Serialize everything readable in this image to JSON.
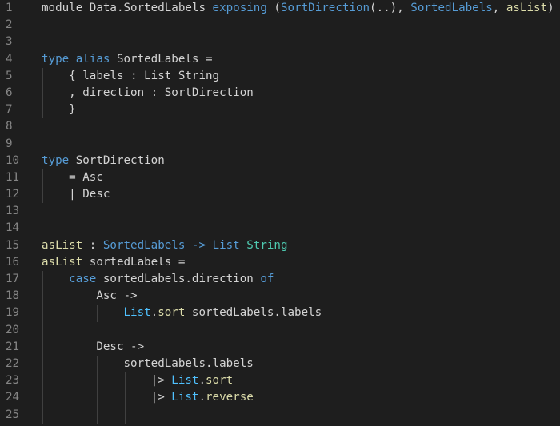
{
  "colors": {
    "background": "#1e1e1e",
    "line_number": "#858585",
    "plain": "#d4d4d4",
    "keyword": "#569cd6",
    "function": "#dcdcaa",
    "type": "#4ec9b0",
    "module": "#4fc1ff",
    "indent_guide": "#404040"
  },
  "lines": [
    {
      "n": "1",
      "guides": 0,
      "tokens": [
        {
          "t": "module ",
          "c": "plain"
        },
        {
          "t": "Data.SortedLabels ",
          "c": "plain"
        },
        {
          "t": "exposing",
          "c": "keyword"
        },
        {
          "t": " (",
          "c": "plain"
        },
        {
          "t": "SortDirection",
          "c": "keyword"
        },
        {
          "t": "(..), ",
          "c": "plain"
        },
        {
          "t": "SortedLabels",
          "c": "keyword"
        },
        {
          "t": ", ",
          "c": "plain"
        },
        {
          "t": "asList",
          "c": "function"
        },
        {
          "t": ")",
          "c": "plain"
        }
      ]
    },
    {
      "n": "2",
      "guides": 0,
      "tokens": []
    },
    {
      "n": "3",
      "guides": 0,
      "tokens": []
    },
    {
      "n": "4",
      "guides": 0,
      "tokens": [
        {
          "t": "type",
          "c": "keyword"
        },
        {
          "t": " ",
          "c": "plain"
        },
        {
          "t": "alias",
          "c": "keyword"
        },
        {
          "t": " SortedLabels =",
          "c": "plain"
        }
      ]
    },
    {
      "n": "5",
      "guides": 1,
      "tokens": [
        {
          "t": "    { labels : List String",
          "c": "plain"
        }
      ]
    },
    {
      "n": "6",
      "guides": 1,
      "tokens": [
        {
          "t": "    , direction : SortDirection",
          "c": "plain"
        }
      ]
    },
    {
      "n": "7",
      "guides": 1,
      "tokens": [
        {
          "t": "    }",
          "c": "plain"
        }
      ]
    },
    {
      "n": "8",
      "guides": 0,
      "tokens": []
    },
    {
      "n": "9",
      "guides": 0,
      "tokens": []
    },
    {
      "n": "10",
      "guides": 0,
      "tokens": [
        {
          "t": "type",
          "c": "keyword"
        },
        {
          "t": " SortDirection",
          "c": "plain"
        }
      ]
    },
    {
      "n": "11",
      "guides": 1,
      "tokens": [
        {
          "t": "    = Asc",
          "c": "plain"
        }
      ]
    },
    {
      "n": "12",
      "guides": 1,
      "tokens": [
        {
          "t": "    | Desc",
          "c": "plain"
        }
      ]
    },
    {
      "n": "13",
      "guides": 0,
      "tokens": []
    },
    {
      "n": "14",
      "guides": 0,
      "tokens": []
    },
    {
      "n": "15",
      "guides": 0,
      "tokens": [
        {
          "t": "asList",
          "c": "function"
        },
        {
          "t": " : ",
          "c": "plain"
        },
        {
          "t": "SortedLabels",
          "c": "keyword"
        },
        {
          "t": " -> ",
          "c": "keyword"
        },
        {
          "t": "List",
          "c": "keyword"
        },
        {
          "t": " ",
          "c": "plain"
        },
        {
          "t": "String",
          "c": "type"
        }
      ]
    },
    {
      "n": "16",
      "guides": 0,
      "tokens": [
        {
          "t": "asList",
          "c": "function"
        },
        {
          "t": " sortedLabels =",
          "c": "plain"
        }
      ]
    },
    {
      "n": "17",
      "guides": 1,
      "tokens": [
        {
          "t": "    ",
          "c": "plain"
        },
        {
          "t": "case",
          "c": "keyword"
        },
        {
          "t": " sortedLabels.direction ",
          "c": "plain"
        },
        {
          "t": "of",
          "c": "keyword"
        }
      ]
    },
    {
      "n": "18",
      "guides": 2,
      "tokens": [
        {
          "t": "        Asc ->",
          "c": "plain"
        }
      ]
    },
    {
      "n": "19",
      "guides": 3,
      "tokens": [
        {
          "t": "            ",
          "c": "plain"
        },
        {
          "t": "List",
          "c": "module"
        },
        {
          "t": ".",
          "c": "plain"
        },
        {
          "t": "sort",
          "c": "function"
        },
        {
          "t": " sortedLabels.labels",
          "c": "plain"
        }
      ]
    },
    {
      "n": "20",
      "guides": 2,
      "tokens": []
    },
    {
      "n": "21",
      "guides": 2,
      "tokens": [
        {
          "t": "        Desc ->",
          "c": "plain"
        }
      ]
    },
    {
      "n": "22",
      "guides": 3,
      "tokens": [
        {
          "t": "            sortedLabels.labels",
          "c": "plain"
        }
      ]
    },
    {
      "n": "23",
      "guides": 4,
      "tokens": [
        {
          "t": "                |> ",
          "c": "plain"
        },
        {
          "t": "List",
          "c": "module"
        },
        {
          "t": ".",
          "c": "plain"
        },
        {
          "t": "sort",
          "c": "function"
        }
      ]
    },
    {
      "n": "24",
      "guides": 4,
      "tokens": [
        {
          "t": "                |> ",
          "c": "plain"
        },
        {
          "t": "List",
          "c": "module"
        },
        {
          "t": ".",
          "c": "plain"
        },
        {
          "t": "reverse",
          "c": "function"
        }
      ]
    },
    {
      "n": "25",
      "guides": 4,
      "tokens": []
    }
  ]
}
